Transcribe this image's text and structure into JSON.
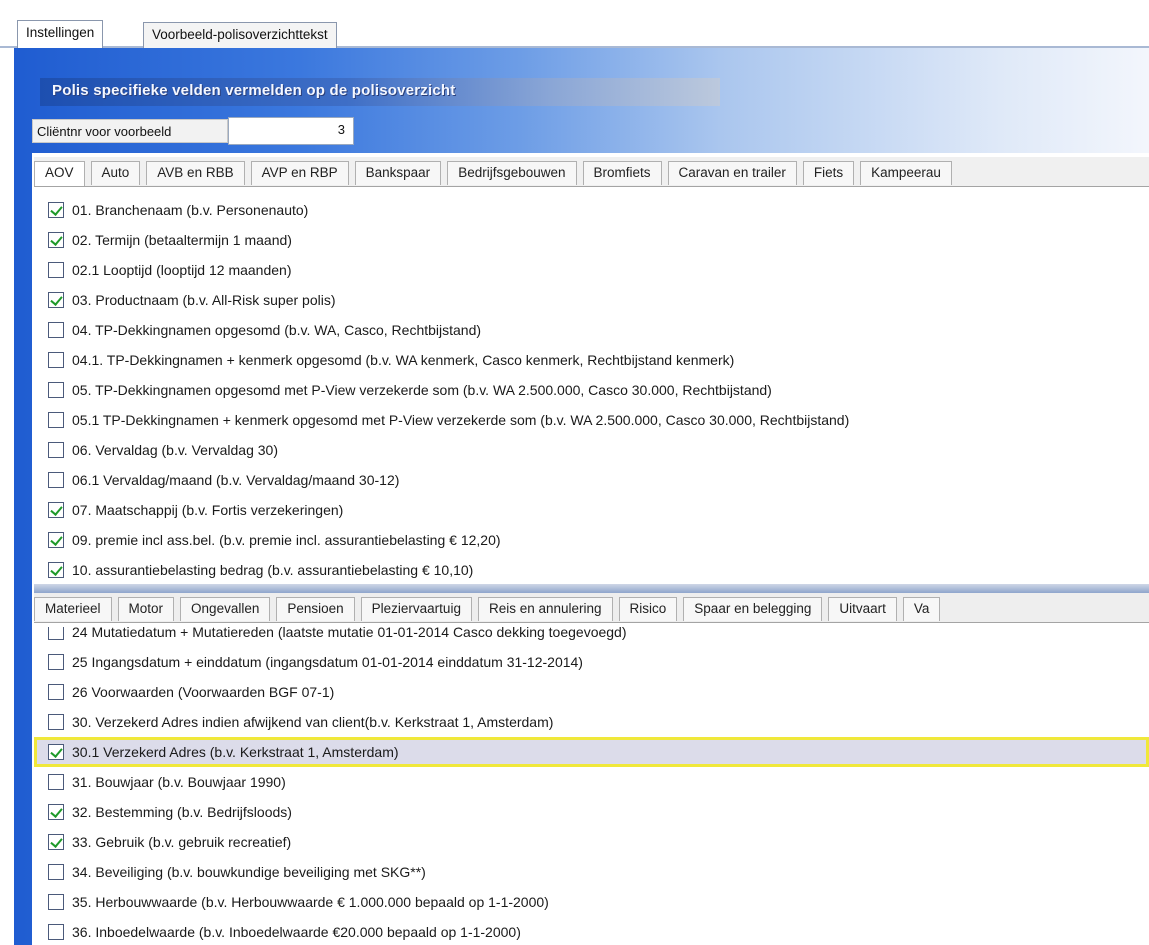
{
  "top_tabs": [
    {
      "label": "Instellingen",
      "active": true
    },
    {
      "label": "Voorbeeld-polisoverzichttekst",
      "active": false
    }
  ],
  "section_title": "Polis specifieke velden vermelden op de polisoverzicht",
  "client": {
    "label": "Cliëntnr voor voorbeeld",
    "value": "3"
  },
  "tabs_row1": [
    {
      "label": "AOV",
      "active": true
    },
    {
      "label": "Auto"
    },
    {
      "label": "AVB en RBB"
    },
    {
      "label": "AVP en RBP"
    },
    {
      "label": "Bankspaar"
    },
    {
      "label": "Bedrijfsgebouwen"
    },
    {
      "label": "Bromfiets"
    },
    {
      "label": "Caravan en trailer"
    },
    {
      "label": "Fiets"
    },
    {
      "label": "Kampeerau"
    }
  ],
  "list1": [
    {
      "label": "01. Branchenaam (b.v. Personenauto)",
      "checked": true
    },
    {
      "label": "02. Termijn (betaaltermijn 1 maand)",
      "checked": true
    },
    {
      "label": "02.1 Looptijd (looptijd 12 maanden)",
      "checked": false
    },
    {
      "label": "03. Productnaam (b.v. All-Risk super polis)",
      "checked": true
    },
    {
      "label": "04. TP-Dekkingnamen opgesomd (b.v. WA, Casco, Rechtbijstand)",
      "checked": false
    },
    {
      "label": "04.1. TP-Dekkingnamen + kenmerk opgesomd (b.v. WA kenmerk, Casco kenmerk, Rechtbijstand kenmerk)",
      "checked": false
    },
    {
      "label": "05. TP-Dekkingnamen opgesomd met P-View verzekerde som (b.v. WA 2.500.000, Casco 30.000, Rechtbijstand)",
      "checked": false
    },
    {
      "label": "05.1 TP-Dekkingnamen + kenmerk opgesomd met P-View verzekerde som (b.v. WA 2.500.000, Casco 30.000, Rechtbijstand)",
      "checked": false
    },
    {
      "label": "06. Vervaldag (b.v. Vervaldag 30)",
      "checked": false
    },
    {
      "label": "06.1 Vervaldag/maand (b.v. Vervaldag/maand 30-12)",
      "checked": false
    },
    {
      "label": "07. Maatschappij (b.v. Fortis verzekeringen)",
      "checked": true
    },
    {
      "label": "09. premie incl ass.bel. (b.v. premie incl. assurantiebelasting € 12,20)",
      "checked": true
    },
    {
      "label": "10. assurantiebelasting bedrag (b.v. assurantiebelasting € 10,10)",
      "checked": true
    }
  ],
  "tabs_row2": [
    {
      "label": "Materieel"
    },
    {
      "label": "Motor"
    },
    {
      "label": "Ongevallen"
    },
    {
      "label": "Pensioen"
    },
    {
      "label": "Pleziervaartuig"
    },
    {
      "label": "Reis en annulering"
    },
    {
      "label": "Risico"
    },
    {
      "label": "Spaar en belegging"
    },
    {
      "label": "Uitvaart"
    },
    {
      "label": "Va"
    }
  ],
  "list2": [
    {
      "label": "24 Mutatiedatum + Mutatiereden (laatste mutatie 01-01-2014 Casco dekking toegevoegd)",
      "checked": false
    },
    {
      "label": "25 Ingangsdatum + einddatum (ingangsdatum 01-01-2014 einddatum 31-12-2014)",
      "checked": false
    },
    {
      "label": "26 Voorwaarden (Voorwaarden BGF 07-1)",
      "checked": false
    },
    {
      "label": "30. Verzekerd Adres indien afwijkend van client(b.v. Kerkstraat 1, Amsterdam)",
      "checked": false
    },
    {
      "label": "30.1 Verzekerd Adres (b.v. Kerkstraat 1, Amsterdam)",
      "checked": true,
      "highlighted": true
    },
    {
      "label": "31. Bouwjaar (b.v. Bouwjaar 1990)",
      "checked": false
    },
    {
      "label": "32. Bestemming (b.v. Bedrijfsloods)",
      "checked": true
    },
    {
      "label": "33. Gebruik (b.v. gebruik recreatief)",
      "checked": true
    },
    {
      "label": "34. Beveiliging (b.v. bouwkundige beveiliging met SKG**)",
      "checked": false
    },
    {
      "label": "35. Herbouwwaarde (b.v. Herbouwwaarde € 1.000.000 bepaald op 1-1-2000)",
      "checked": false
    },
    {
      "label": "36. Inboedelwaarde (b.v. Inboedelwaarde €20.000 bepaald op 1-1-2000)",
      "checked": false
    }
  ]
}
